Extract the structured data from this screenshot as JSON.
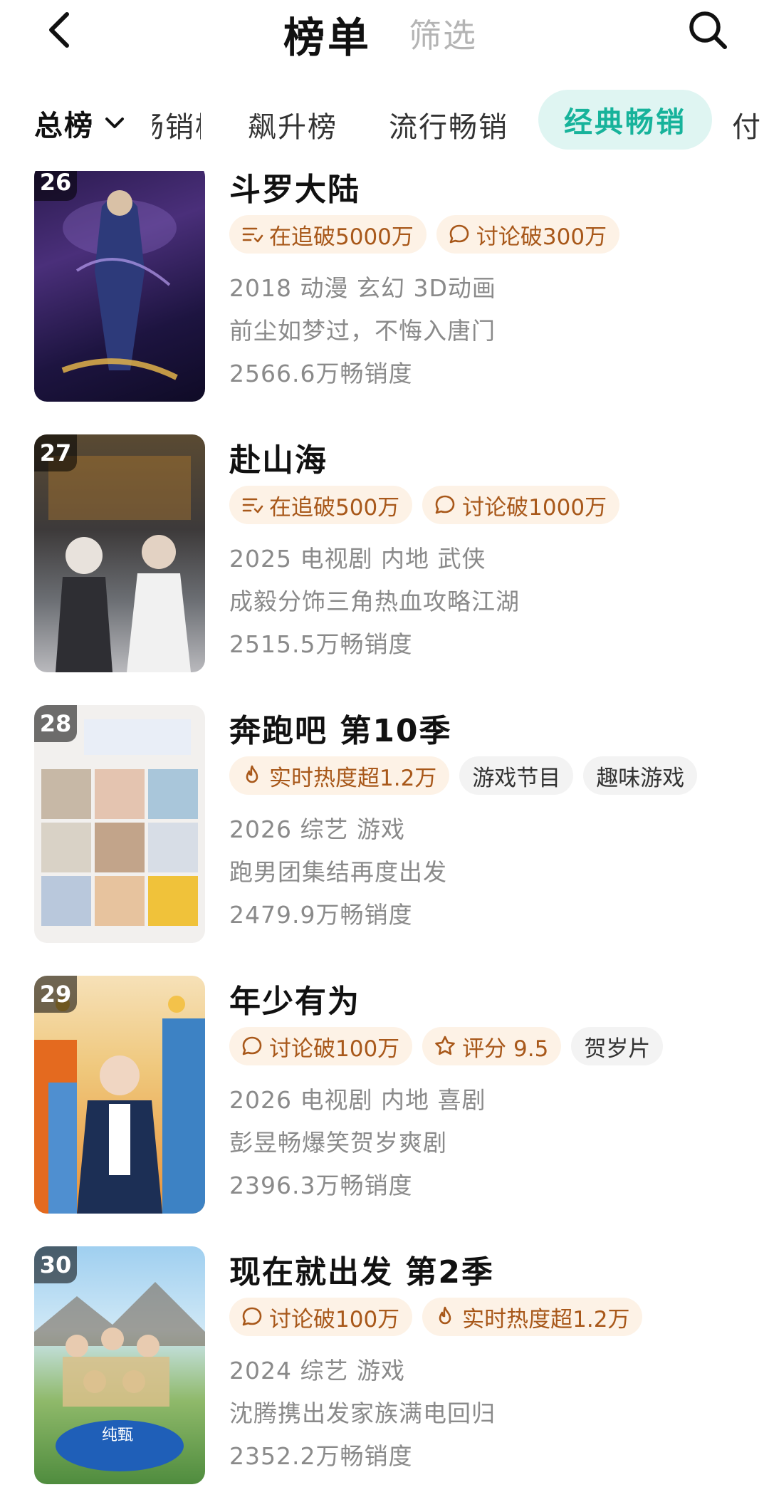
{
  "header": {
    "title": "榜单",
    "filter_label": "筛选",
    "back_icon": "chevron-left-icon",
    "search_icon": "search-icon"
  },
  "tabs": {
    "total_label": "总榜",
    "clipped_label": "畅销榜",
    "items": [
      {
        "label": "飙升榜"
      },
      {
        "label": "流行畅销"
      },
      {
        "label": "经典畅销",
        "active": true
      },
      {
        "label": "付"
      }
    ]
  },
  "colors": {
    "accent": "#17b39b",
    "accent_bg": "#dff5f2",
    "tag_orange_text": "#a8581a",
    "tag_orange_bg": "#fdf2e6"
  },
  "items": [
    {
      "rank": "26",
      "title": "斗罗大陆",
      "tags": [
        {
          "icon": "follow-list-icon",
          "text": "在追破5000万"
        },
        {
          "icon": "comment-bubble-icon",
          "text": "讨论破300万"
        }
      ],
      "meta": "2018 动漫 玄幻 3D动画",
      "desc": "前尘如梦过，不悔入唐门",
      "sales": "2566.6万畅销度"
    },
    {
      "rank": "27",
      "title": "赴山海",
      "tags": [
        {
          "icon": "follow-list-icon",
          "text": "在追破500万"
        },
        {
          "icon": "comment-bubble-icon",
          "text": "讨论破1000万"
        }
      ],
      "meta": "2025 电视剧 内地 武侠",
      "desc": "成毅分饰三角热血攻略江湖",
      "sales": "2515.5万畅销度"
    },
    {
      "rank": "28",
      "title": "奔跑吧 第10季",
      "tags": [
        {
          "icon": "flame-icon",
          "text": "实时热度超1.2万"
        },
        {
          "text": "游戏节目"
        },
        {
          "text": "趣味游戏"
        }
      ],
      "meta": "2026 综艺 游戏",
      "desc": "跑男团集结再度出发",
      "sales": "2479.9万畅销度"
    },
    {
      "rank": "29",
      "title": "年少有为",
      "tags": [
        {
          "icon": "comment-bubble-icon",
          "text": "讨论破100万"
        },
        {
          "icon": "star-icon",
          "text": "评分 9.5"
        },
        {
          "text": "贺岁片"
        }
      ],
      "meta": "2026 电视剧 内地 喜剧",
      "desc": "彭昱畅爆笑贺岁爽剧",
      "sales": "2396.3万畅销度"
    },
    {
      "rank": "30",
      "title": "现在就出发 第2季",
      "tags": [
        {
          "icon": "comment-bubble-icon",
          "text": "讨论破100万"
        },
        {
          "icon": "flame-icon",
          "text": "实时热度超1.2万"
        }
      ],
      "meta": "2024 综艺 游戏",
      "desc": "沈腾携出发家族满电回归",
      "sales": "2352.2万畅销度"
    }
  ]
}
